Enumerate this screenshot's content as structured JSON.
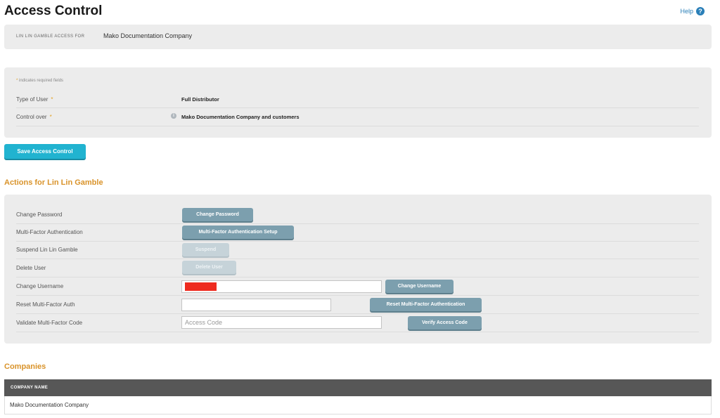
{
  "page": {
    "title": "Access Control",
    "help_label": "Help",
    "help_icon": "?"
  },
  "access_for": {
    "label": "LIN LIN GAMBLE ACCESS FOR",
    "value": "Mako Documentation Company"
  },
  "form": {
    "required_star": "*",
    "required_note": "indicates required fields",
    "rows": [
      {
        "label": "Type of User",
        "value": "Full Distributor"
      },
      {
        "label": "Control over",
        "value": "Mako Documentation Company and customers"
      }
    ],
    "info_icon": "i"
  },
  "save_button": "Save Access Control",
  "actions": {
    "title": "Actions for Lin Lin Gamble",
    "rows": [
      {
        "label": "Change Password",
        "button": "Change Password"
      },
      {
        "label": "Multi-Factor Authentication",
        "button": "Multi-Factor Authentication Setup"
      },
      {
        "label": "Suspend Lin Lin Gamble",
        "button": "Suspend"
      },
      {
        "label": "Delete User",
        "button": "Delete User"
      },
      {
        "label": "Change Username",
        "button": "Change Username",
        "input_value": ""
      },
      {
        "label": "Reset Multi-Factor Auth",
        "button": "Reset Multi-Factor Authentication",
        "input_value": ""
      },
      {
        "label": "Validate Multi-Factor Code",
        "button": "Verify Access Code",
        "input_placeholder": "Access Code"
      }
    ]
  },
  "companies": {
    "title": "Companies",
    "header": "COMPANY NAME",
    "rows": [
      "Mako Documentation Company"
    ]
  },
  "colors": {
    "accent": "#d9932a",
    "primary": "#21b3d0",
    "action": "#7c9fae",
    "link": "#2a7fb8"
  }
}
